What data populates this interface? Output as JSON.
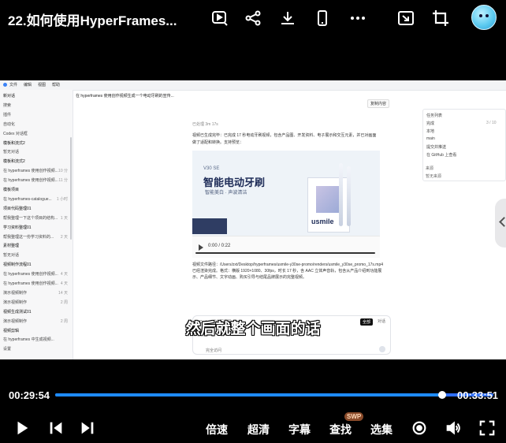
{
  "header": {
    "title": "22.如何使用HyperFrames...",
    "icons": [
      "screen-record-icon",
      "share-icon",
      "download-icon",
      "phone-icon",
      "more-icon",
      "pip-icon",
      "crop-icon"
    ]
  },
  "screen": {
    "menu": [
      "文件",
      "编辑",
      "视图",
      "帮助"
    ],
    "sidebar": [
      {
        "label": "新对话",
        "time": "",
        "bold": true
      },
      {
        "label": "搜索",
        "time": "",
        "bold": false
      },
      {
        "label": "插件",
        "time": "",
        "bold": false
      },
      {
        "label": "自动化",
        "time": "",
        "bold": false
      },
      {
        "label": "Codex 对话框",
        "time": "",
        "bold": false
      },
      {
        "label": "模板和流式2",
        "time": "",
        "bold": true
      },
      {
        "label": "暂无对话",
        "time": "",
        "bold": false
      },
      {
        "label": "模板和流式2",
        "time": "",
        "bold": true
      },
      {
        "label": "在 hyperframes 使用创作视频...",
        "time": "10 分",
        "bold": false
      },
      {
        "label": "在 hyperframes 使用创作视频...",
        "time": "11 分",
        "bold": false
      },
      {
        "label": "模板项目",
        "time": "",
        "bold": true
      },
      {
        "label": "在 hyperframes-catalogue...",
        "time": "1 小时",
        "bold": false
      },
      {
        "label": "项目代码整理01",
        "time": "",
        "bold": true
      },
      {
        "label": "帮我整理一下这个项目的结构...",
        "time": "1 天",
        "bold": false
      },
      {
        "label": "学习资料整理01",
        "time": "",
        "bold": true
      },
      {
        "label": "帮我整理这一份学习资料的...",
        "time": "2 天",
        "bold": false
      },
      {
        "label": "素材整理",
        "time": "",
        "bold": true
      },
      {
        "label": "暂无对话",
        "time": "",
        "bold": false
      },
      {
        "label": "视频制作流程01",
        "time": "",
        "bold": true
      },
      {
        "label": "在 hyperframes 使用创作视频...",
        "time": "4 天",
        "bold": false
      },
      {
        "label": "在 hyperframes 使用创作视频...",
        "time": "4 天",
        "bold": false
      },
      {
        "label": "演示视频制作",
        "time": "14 天",
        "bold": false
      },
      {
        "label": "演示视频制作",
        "time": "2 周",
        "bold": false
      },
      {
        "label": "视频生成测试01",
        "time": "",
        "bold": true
      },
      {
        "label": "演示视频制作",
        "time": "2 周",
        "bold": false
      },
      {
        "label": "视频剪辑",
        "time": "",
        "bold": true
      },
      {
        "label": "在 hyperframes 中生成视频...",
        "time": "",
        "bold": false
      },
      {
        "label": "设置",
        "time": "",
        "bold": false
      }
    ],
    "chat_header": "在 hyperframes 使用创作视频生成一个电动牙刷的宣传...",
    "copy_button": "复制内容",
    "meta": "已处理 3m 17s",
    "para1": "视频已生成完毕：已完成 17 秒电动牙刷视频，包含产品图、开发资料、电子展示和交互元素，并已对画面做了适配和转换。支持预览：",
    "video": {
      "brand": "V30 SE",
      "headline": "智能电动牙刷",
      "subline": "智能美白 · 声波清洁",
      "box_logo": "usmile",
      "time": "0:00 / 0:22"
    },
    "para2": "视频文件路径：/Users/zxt/Desktop/hyperframes/usmile-y30se-promo/renders/usmile_y30se_promo_17s.mp4 已经渲染完成。格式：横版 1920×1080、30fps，时长 17 秒，含 AAC 立体声音轨，包含从产品介绍到功能展示、产品细节、文字动画、购买引导与结尾品牌展示的完整视频。",
    "input": {
      "row": "Codex 帮你写代码",
      "chip1": "全部",
      "chip2": "对话",
      "placeholder": "完全访问"
    },
    "rpanel": [
      {
        "label": "任务列表",
        "value": ""
      },
      {
        "label": "完成",
        "value": "3 / 10"
      },
      {
        "label": "本地",
        "value": ""
      },
      {
        "label": "main",
        "value": ""
      },
      {
        "label": "提交并推送",
        "value": ""
      },
      {
        "label": "在 GitHub 上查看",
        "value": ""
      }
    ],
    "rpanel_extra": [
      "来源",
      "暂无来源"
    ]
  },
  "subtitle": "然后就整个画面的话",
  "player": {
    "current_time": "00:29:54",
    "duration": "00:33:51",
    "progress": 0.883,
    "controls": {
      "speed": "倍速",
      "quality": "超清",
      "captions": "字幕",
      "search": "查找",
      "episodes": "选集",
      "badge": "SWP"
    }
  }
}
